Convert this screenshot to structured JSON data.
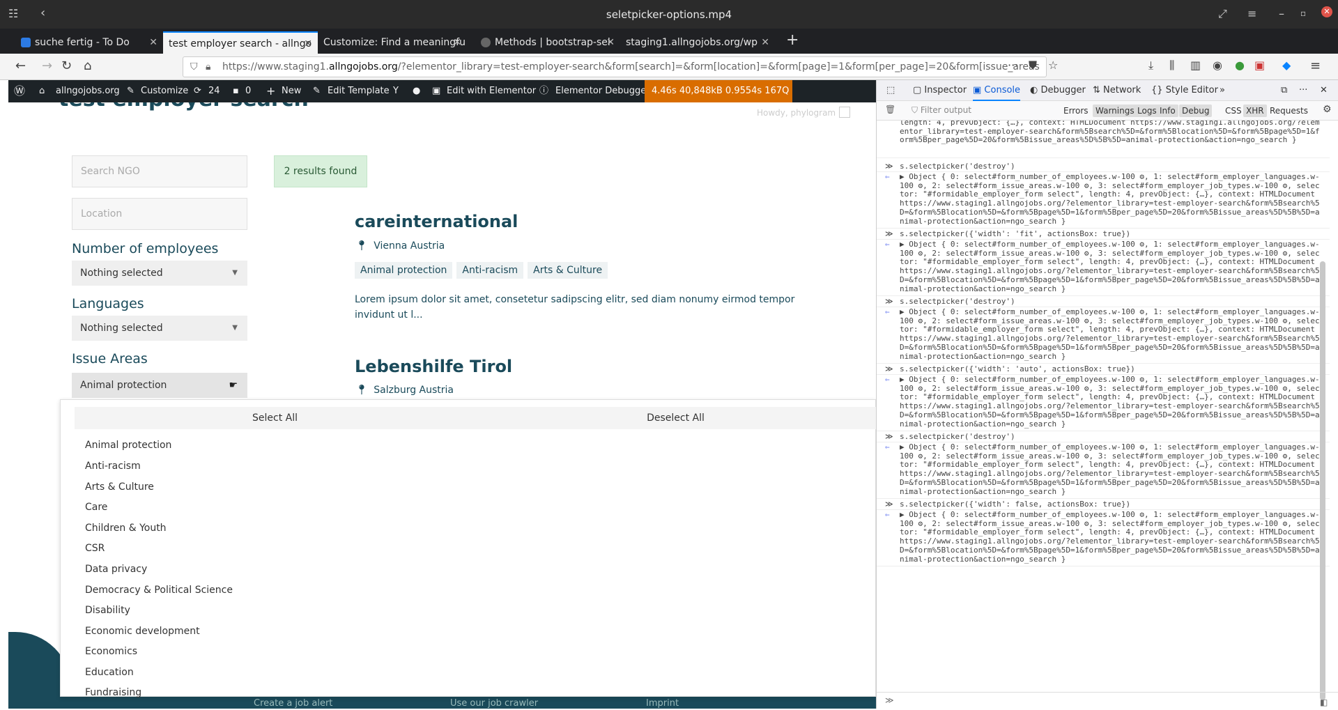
{
  "window": {
    "title": "seletpicker-options.mp4"
  },
  "tabs": [
    {
      "label": "suche fertig - To Do",
      "active": false,
      "color": "#2c7be5"
    },
    {
      "label": "test employer search - allngo",
      "active": true,
      "color": "#444"
    },
    {
      "label": "Customize: Find a meaningfu",
      "active": false,
      "color": "#444"
    },
    {
      "label": "Methods | bootstrap-sel",
      "active": false,
      "color": "#888"
    },
    {
      "label": "staging1.allngojobs.org/wp",
      "active": false,
      "color": "#444"
    }
  ],
  "url": {
    "prefix": "https://www.staging1.",
    "host": "allngojobs.org",
    "rest": "/?elementor_library=test-employer-search&form[search]=&form[location]=&form[page]=1&form[per_page]=20&form[issue_areas"
  },
  "wpbar": {
    "site": "allngojobs.org",
    "customize": "Customize",
    "updates": "24",
    "comments": "0",
    "new": "New",
    "edit_template": "Edit Template",
    "edit_elementor": "Edit with Elementor",
    "debugger": "Elementor Debugger",
    "perf": "4.46s  40,848kB  0.9554s  167Q"
  },
  "page": {
    "title": "test employer search",
    "howdy": "Howdy, phylogram",
    "search_placeholder": "Search NGO",
    "location_placeholder": "Location",
    "results": "2 results found",
    "filters": {
      "employees_label": "Number of employees",
      "employees_value": "Nothing selected",
      "languages_label": "Languages",
      "languages_value": "Nothing selected",
      "issue_label": "Issue Areas",
      "issue_value": "Animal protection"
    },
    "listing1": {
      "name": "careinternational",
      "location": "Vienna Austria",
      "tags": [
        "Animal protection",
        "Anti-racism",
        "Arts & Culture"
      ],
      "desc": "Lorem ipsum dolor sit amet, consetetur sadipscing elitr, sed diam nonumy eirmod tempor invidunt ut l..."
    },
    "listing2": {
      "name": "Lebenshilfe Tirol",
      "location": "Salzburg Austria"
    },
    "footer": [
      "Create a job alert",
      "Use our job crawler",
      "Imprint"
    ]
  },
  "dropdown": {
    "select_all": "Select All",
    "deselect_all": "Deselect All",
    "options": [
      "Animal protection",
      "Anti-racism",
      "Arts & Culture",
      "Care",
      "Children & Youth",
      "CSR",
      "Data privacy",
      "Democracy & Political Science",
      "Disability",
      "Economic development",
      "Economics",
      "Education",
      "Fundraising"
    ]
  },
  "devtools": {
    "tabs": [
      "Inspector",
      "Console",
      "Debugger",
      "Network",
      "Style Editor"
    ],
    "filter_placeholder": "Filter output",
    "filter_buttons": [
      "Errors",
      "Warnings",
      "Logs",
      "Info",
      "Debug",
      "CSS",
      "XHR",
      "Requests"
    ],
    "partial_top": "length: 4, prevObject: {…}, context: HTMLDocument https://www.staging1.allngojobs.org/?elementor_library=test-employer-search&form%5Bsearch%5D=&form%5Blocation%5D=&form%5Bpage%5D=1&form%5Bper_page%5D=20&form%5Bissue_areas%5D%5B%5D=animal-protection&action=ngo_search }",
    "commands": [
      "s.selectpicker('destroy')",
      "s.selectpicker({'width': 'fit', actionsBox: true})",
      "s.selectpicker('destroy')",
      "s.selectpicker({'width': 'auto', actionsBox: true})",
      "s.selectpicker('destroy')",
      "s.selectpicker({'width': false, actionsBox: true})"
    ],
    "result": "▶ Object { 0: select#form_number_of_employees.w-100 ⚙, 1: select#form_employer_languages.w-100 ⚙, 2: select#form_issue_areas.w-100 ⚙, 3: select#form_employer_job_types.w-100 ⚙, selector: \"#formidable_employer_form select\", length: 4, prevObject: {…}, context: HTMLDocument https://www.staging1.allngojobs.org/?elementor_library=test-employer-search&form%5Bsearch%5D=&form%5Blocation%5D=&form%5Bpage%5D=1&form%5Bper_page%5D=20&form%5Bissue_areas%5D%5B%5D=animal-protection&action=ngo_search }"
  }
}
